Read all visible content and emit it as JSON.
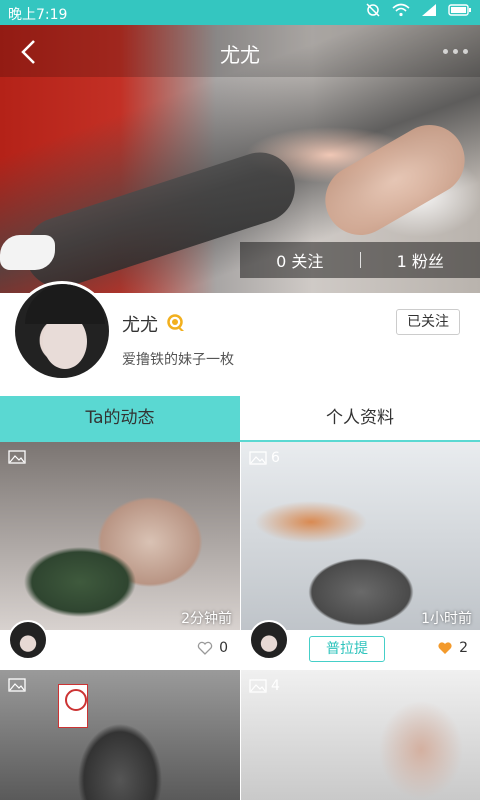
{
  "status_bar": {
    "time": "晚上7:19",
    "icons": [
      "alarm-off-icon",
      "wifi-icon",
      "signal-icon",
      "battery-icon"
    ]
  },
  "header": {
    "title": "尤尤",
    "back_icon": "chevron-left-icon",
    "more_icon": "more-dots-icon"
  },
  "stats": {
    "following": "0 关注",
    "followers": "1 粉丝"
  },
  "profile": {
    "name": "尤尤",
    "badge_icon": "vip-medal-icon",
    "bio": "爱撸铁的妹子一枚",
    "follow_button": "已关注"
  },
  "tabs": [
    {
      "label": "Ta的动态",
      "active": true
    },
    {
      "label": "个人资料",
      "active": false
    }
  ],
  "feed": [
    {
      "image_count": "",
      "time": "2分钟前",
      "likes": "0",
      "liked": false,
      "tag": ""
    },
    {
      "image_count": "6",
      "time": "1小时前",
      "likes": "2",
      "liked": true,
      "tag": "普拉提"
    },
    {
      "image_count": "",
      "time": "",
      "likes": "",
      "liked": false,
      "tag": ""
    },
    {
      "image_count": "4",
      "time": "",
      "likes": "",
      "liked": false,
      "tag": ""
    }
  ],
  "colors": {
    "accent": "#5ad8d2",
    "status_bar": "#34c6c0",
    "like_active": "#f39a2c"
  }
}
